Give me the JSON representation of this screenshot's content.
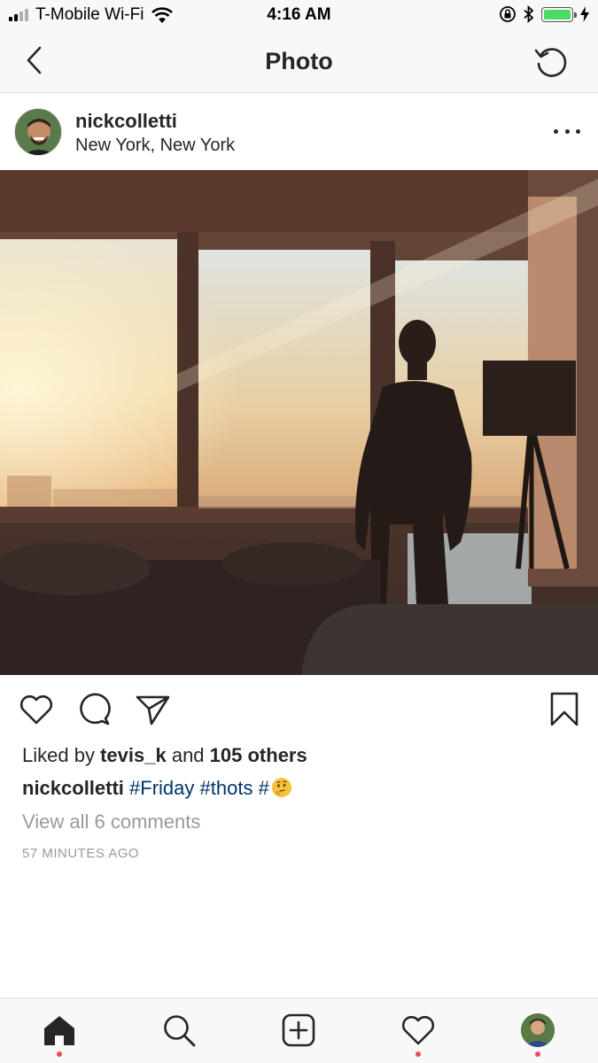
{
  "status_bar": {
    "carrier": "T-Mobile Wi-Fi",
    "time": "4:16 AM",
    "battery_color": "#4cd964",
    "icons": [
      "signal-icon",
      "wifi-icon",
      "orientation-lock-icon",
      "bluetooth-icon",
      "battery-icon",
      "charging-icon"
    ]
  },
  "nav": {
    "title": "Photo",
    "back_icon": "chevron-left-icon",
    "refresh_icon": "refresh-icon"
  },
  "post": {
    "username": "nickcolletti",
    "location": "New York, New York",
    "likes": {
      "prefix": "Liked by",
      "liker": "tevis_k",
      "joiner": "and",
      "others": "105 others"
    },
    "caption": {
      "author": "nickcolletti",
      "hashtags": [
        "#Friday",
        "#thots",
        "#"
      ],
      "emoji": "thinking-face-emoji"
    },
    "view_comments": "View all 6 comments",
    "timestamp": "57 MINUTES AGO"
  },
  "actions": [
    "heart-icon",
    "comment-icon",
    "share-icon",
    "bookmark-icon"
  ],
  "tab_bar": {
    "tabs": [
      "home-icon",
      "search-icon",
      "add-post-icon",
      "activity-heart-icon",
      "profile-avatar"
    ],
    "notification_color": "#ed4956"
  },
  "colors": {
    "hashtag": "#003569",
    "secondary_text": "#999999",
    "primary_text": "#262626"
  }
}
